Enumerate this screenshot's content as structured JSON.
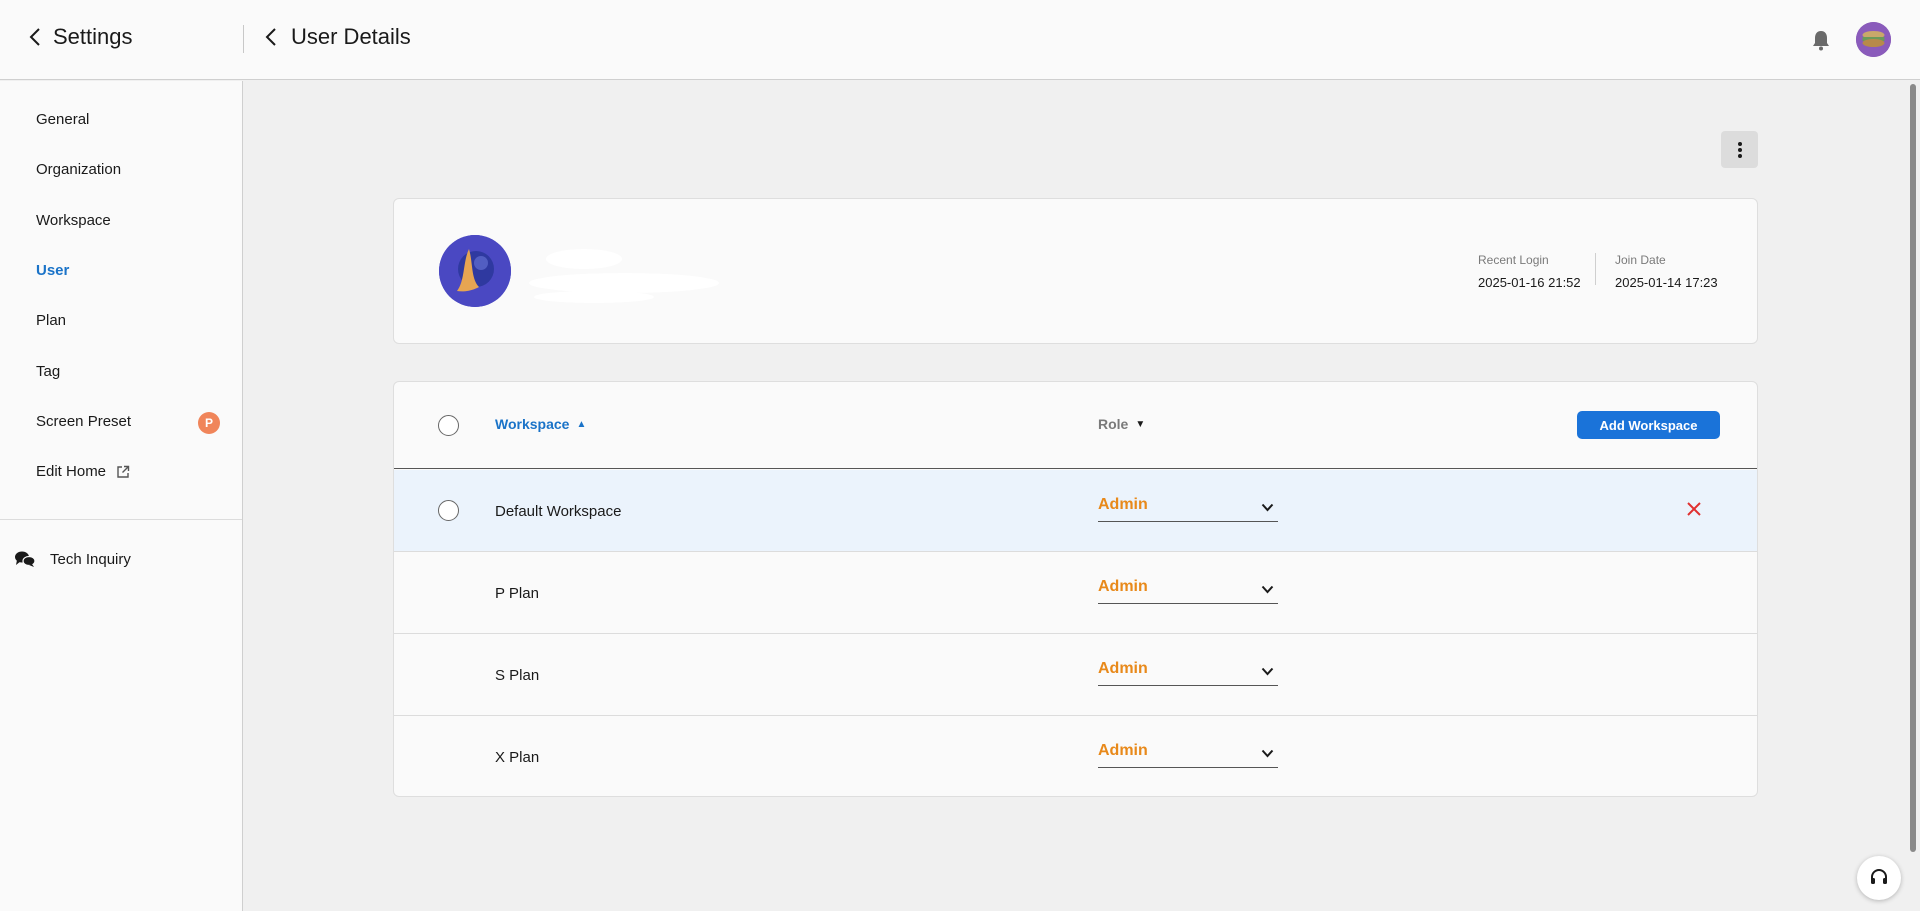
{
  "header": {
    "settings_label": "Settings",
    "page_title": "User Details"
  },
  "sidebar": {
    "items": [
      {
        "label": "General"
      },
      {
        "label": "Organization"
      },
      {
        "label": "Workspace"
      },
      {
        "label": "User"
      },
      {
        "label": "Plan"
      },
      {
        "label": "Tag"
      },
      {
        "label": "Screen Preset",
        "badge": "P"
      },
      {
        "label": "Edit Home"
      }
    ],
    "tech_inquiry": "Tech Inquiry"
  },
  "profile": {
    "recent_login_label": "Recent Login",
    "recent_login_value": "2025-01-16 21:52",
    "join_date_label": "Join Date",
    "join_date_value": "2025-01-14 17:23"
  },
  "table": {
    "col_workspace": "Workspace",
    "col_role": "Role",
    "add_button": "Add Workspace",
    "rows": [
      {
        "workspace": "Default Workspace",
        "role": "Admin"
      },
      {
        "workspace": "P Plan",
        "role": "Admin"
      },
      {
        "workspace": "S Plan",
        "role": "Admin"
      },
      {
        "workspace": "X Plan",
        "role": "Admin"
      }
    ]
  },
  "colors": {
    "accent": "#1a73c8",
    "role": "#e8891a",
    "delete": "#e03030",
    "badge": "#f0855a"
  }
}
